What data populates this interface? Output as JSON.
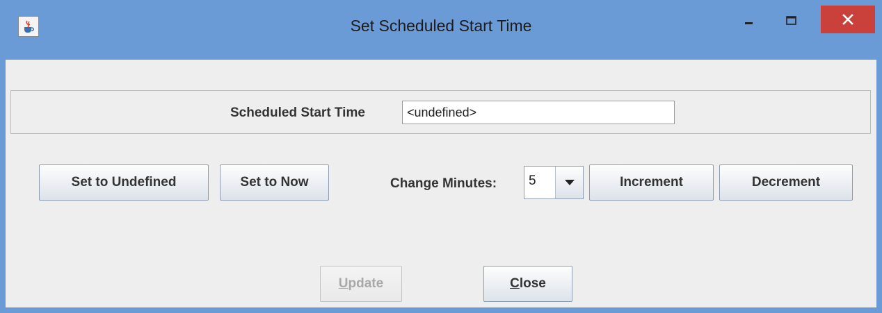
{
  "window": {
    "title": "Set Scheduled Start Time",
    "icon": "java-cup-icon",
    "controls": [
      "minimize-icon",
      "maximize-icon",
      "close-icon"
    ]
  },
  "form": {
    "scheduled_start_label": "Scheduled Start Time",
    "scheduled_start_value": "<undefined>"
  },
  "actions": {
    "set_undefined": "Set to Undefined",
    "set_now": "Set to Now",
    "change_minutes_label": "Change Minutes:",
    "change_minutes_value": "5",
    "increment": "Increment",
    "decrement": "Decrement"
  },
  "footer": {
    "update_mnemonic": "U",
    "update_rest": "pdate",
    "update_enabled": false,
    "close_mnemonic": "C",
    "close_rest": "lose"
  },
  "colors": {
    "titlebar": "#6b9bd6",
    "close_button": "#c9413a",
    "window_bg": "#eeeeee"
  }
}
